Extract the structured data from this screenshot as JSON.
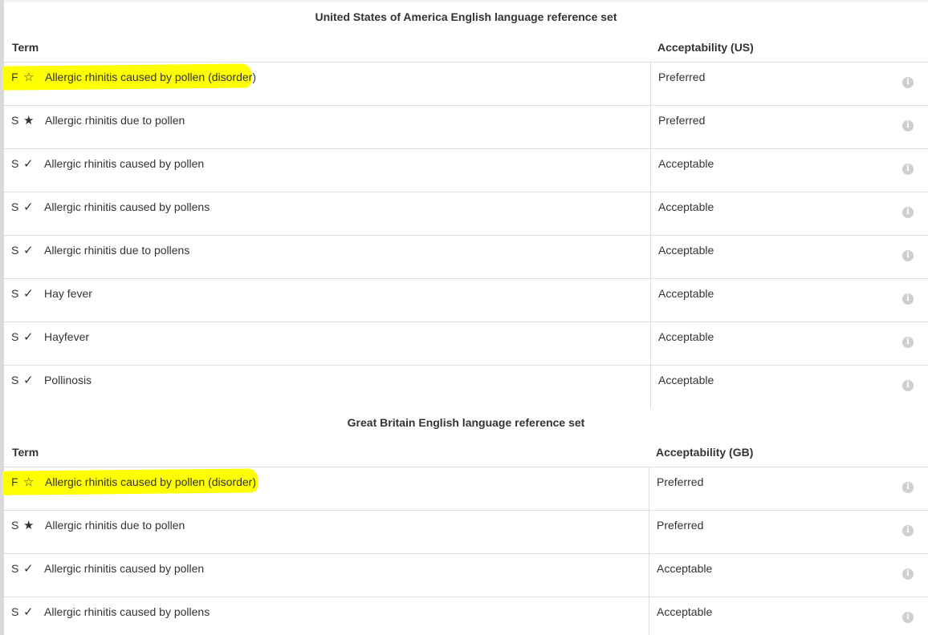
{
  "colors": {
    "highlight": "#ffff00",
    "text": "#333333",
    "border": "#dddddd",
    "info_icon": "#cfcfcf"
  },
  "us_set": {
    "title": "United States of America English language reference set",
    "col_term": "Term",
    "col_acceptability": "Acceptability  (US)",
    "rows": [
      {
        "type": "F",
        "mark": "☆",
        "term": "Allergic rhinitis caused by pollen (disorder)",
        "acceptability": "Preferred",
        "highlighted": true,
        "icon": "info-icon"
      },
      {
        "type": "S",
        "mark": "★",
        "term": "Allergic rhinitis due to pollen",
        "acceptability": "Preferred",
        "icon": "info-icon"
      },
      {
        "type": "S",
        "mark": "✓",
        "term": "Allergic rhinitis caused by pollen",
        "acceptability": "Acceptable",
        "icon": "info-icon"
      },
      {
        "type": "S",
        "mark": "✓",
        "term": "Allergic rhinitis caused by pollens",
        "acceptability": "Acceptable",
        "icon": "info-icon"
      },
      {
        "type": "S",
        "mark": "✓",
        "term": "Allergic rhinitis due to pollens",
        "acceptability": "Acceptable",
        "icon": "info-icon"
      },
      {
        "type": "S",
        "mark": "✓",
        "term": "Hay fever",
        "acceptability": "Acceptable",
        "icon": "info-icon"
      },
      {
        "type": "S",
        "mark": "✓",
        "term": "Hayfever",
        "acceptability": "Acceptable",
        "icon": "info-icon"
      },
      {
        "type": "S",
        "mark": "✓",
        "term": "Pollinosis",
        "acceptability": "Acceptable",
        "icon": "info-icon"
      }
    ]
  },
  "gb_set": {
    "title": "Great Britain English language reference set",
    "col_term": "Term",
    "col_acceptability": "Acceptability  (GB)",
    "rows": [
      {
        "type": "F",
        "mark": "☆",
        "term": "Allergic rhinitis caused by pollen (disorder)",
        "acceptability": "Preferred",
        "highlighted": true,
        "icon": "info-icon"
      },
      {
        "type": "S",
        "mark": "★",
        "term": "Allergic rhinitis due to pollen",
        "acceptability": "Preferred",
        "icon": "info-icon"
      },
      {
        "type": "S",
        "mark": "✓",
        "term": "Allergic rhinitis caused by pollen",
        "acceptability": "Acceptable",
        "icon": "info-icon"
      },
      {
        "type": "S",
        "mark": "✓",
        "term": "Allergic rhinitis caused by pollens",
        "acceptability": "Acceptable",
        "icon": "info-icon"
      }
    ]
  }
}
